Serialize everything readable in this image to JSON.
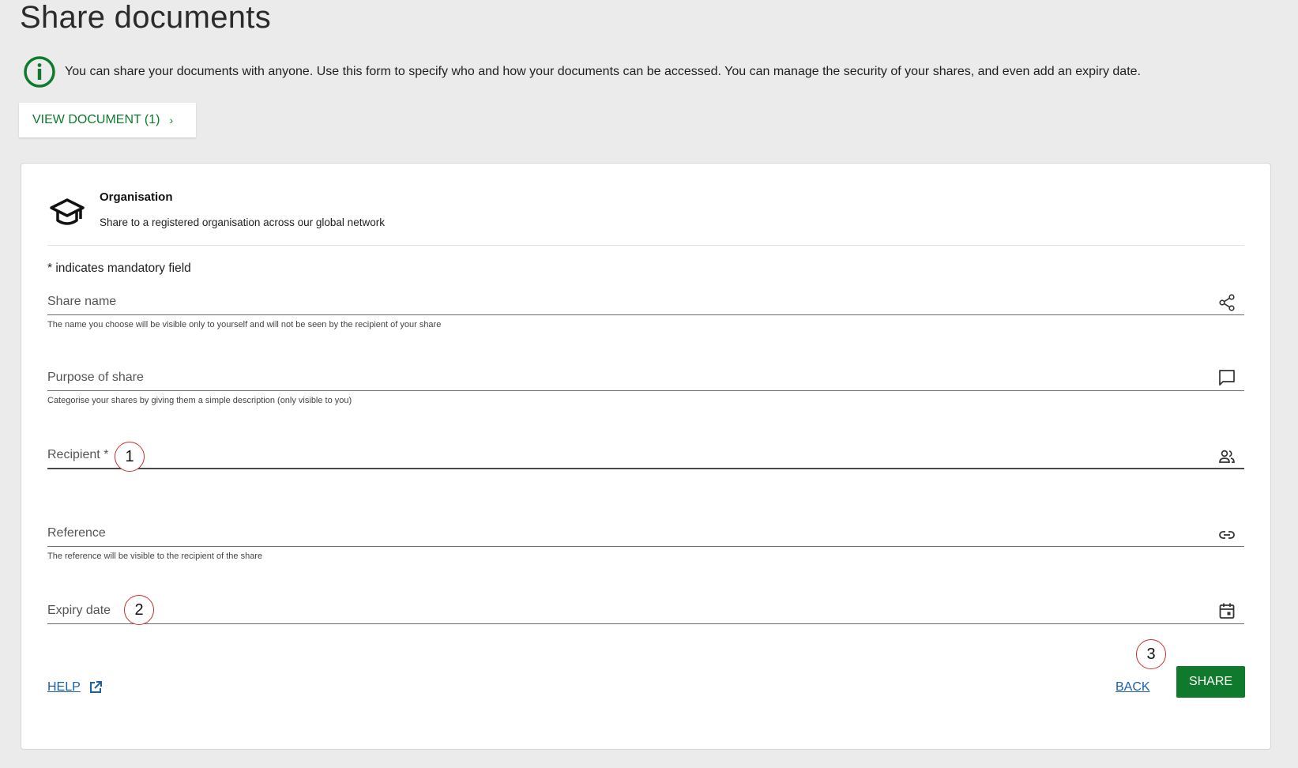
{
  "page": {
    "title": "Share documents"
  },
  "info": {
    "text": "You can share your documents with anyone. Use this form to specify who and how your documents can be accessed. You can manage the security of your shares, and even add an expiry date."
  },
  "view_document": {
    "label": "VIEW DOCUMENT (1)",
    "chevron": "›"
  },
  "organisation": {
    "title": "Organisation",
    "subtitle": "Share to a registered organisation across our global network",
    "icon": "graduation-cap-icon"
  },
  "form": {
    "mandatory_note": "* indicates mandatory field",
    "share_name": {
      "label": "Share name",
      "hint": "The name you choose will be visible only to yourself and will not be seen by the recipient of your share",
      "icon": "share-icon"
    },
    "purpose": {
      "label": "Purpose of share",
      "hint": "Categorise your shares by giving them a simple description (only visible to you)",
      "icon": "comment-icon"
    },
    "recipient": {
      "label": "Recipient *",
      "icon": "people-icon"
    },
    "reference": {
      "label": "Reference",
      "hint": "The reference will be visible to the recipient of the share",
      "icon": "link-icon"
    },
    "expiry": {
      "label": "Expiry date",
      "icon": "calendar-icon"
    }
  },
  "callouts": [
    "1",
    "2",
    "3"
  ],
  "actions": {
    "help": "HELP",
    "back": "BACK",
    "share": "SHARE"
  },
  "colors": {
    "accent": "#0f7a2b",
    "link": "#1a5fa8",
    "callout": "#c9302c"
  }
}
